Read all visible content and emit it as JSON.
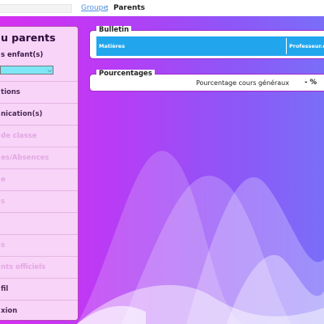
{
  "breadcrumb": {
    "link": "Groupe",
    "separator": ":",
    "current": "Parents"
  },
  "sidebar": {
    "title": "u parents",
    "child_label": "s enfant(s)",
    "child_select_value": "",
    "items": [
      {
        "label": "tions",
        "enabled": true
      },
      {
        "label": "nication(s)",
        "enabled": true
      },
      {
        "label": "de classe",
        "enabled": false
      },
      {
        "label": "es/Absences",
        "enabled": false
      },
      {
        "label": "e",
        "enabled": false
      },
      {
        "label": "s",
        "enabled": false
      },
      {
        "label": "",
        "enabled": false
      },
      {
        "label": "s",
        "enabled": false
      },
      {
        "label": "nts officiels",
        "enabled": false
      },
      {
        "label": "fil",
        "enabled": true
      },
      {
        "label": "xion",
        "enabled": true
      }
    ]
  },
  "bulletin": {
    "legend": "Bulletin",
    "columns": [
      "Matières",
      "Professeur.e..."
    ]
  },
  "pourcentages": {
    "legend": "Pourcentages",
    "label": "Pourcentage cours généraux",
    "value": "- %"
  },
  "colors": {
    "gradient_left": "#d62ff2",
    "gradient_right": "#7a6ef8",
    "sidebar_bg": "#f8d4f8",
    "table_header": "#21a6ee",
    "link": "#4a8fe0"
  }
}
